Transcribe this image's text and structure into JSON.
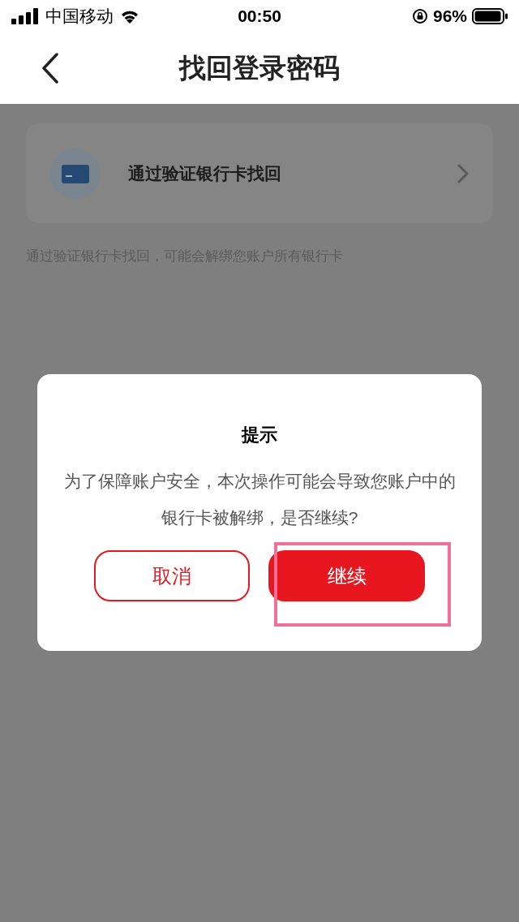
{
  "status_bar": {
    "carrier": "中国移动",
    "time": "00:50",
    "battery": "96%"
  },
  "header": {
    "title": "找回登录密码"
  },
  "options": [
    {
      "label": "通过验证银行卡找回"
    }
  ],
  "note": "通过验证银行卡找回，可能会解绑您账户所有银行卡",
  "dialog": {
    "title": "提示",
    "message": "为了保障账户安全，本次操作可能会导致您账户中的银行卡被解绑，是否继续?",
    "buttons": [
      {
        "label": "取消",
        "kind": "secondary",
        "highlighted": false
      },
      {
        "label": "继续",
        "kind": "primary",
        "highlighted": true
      }
    ]
  }
}
